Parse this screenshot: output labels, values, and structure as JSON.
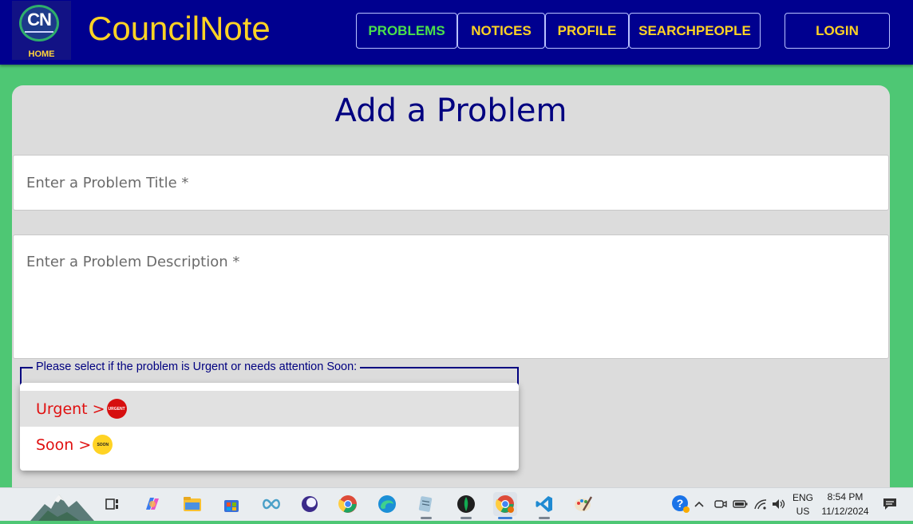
{
  "header": {
    "logo_text": "CN",
    "logo_home": "HOME",
    "brand": "CouncilNote",
    "nav": [
      {
        "label": "PROBLEMS",
        "active": true
      },
      {
        "label": "NOTICES"
      },
      {
        "label": "PROFILE"
      },
      {
        "label": "SEARCHPEOPLE"
      },
      {
        "label": "LOGIN"
      }
    ]
  },
  "form": {
    "title": "Add a Problem",
    "title_placeholder": "Enter a Problem Title *",
    "description_placeholder": "Enter a Problem Description *",
    "priority_legend": "Please select if the problem is Urgent or needs attention Soon:",
    "options": [
      {
        "label": "Urgent >",
        "badge": "URGENT"
      },
      {
        "label": "Soon >",
        "badge": "SOON"
      }
    ]
  },
  "taskbar": {
    "language": "ENG",
    "region": "US",
    "time": "8:54 PM",
    "date": "11/12/2024",
    "apps": [
      "mountain-widget",
      "task-view",
      "copilot",
      "file-explorer",
      "microsoft-store",
      "infinity-app",
      "eclipse-app",
      "chrome",
      "edge",
      "notepad",
      "mongodb-compass",
      "chrome-profile",
      "vscode",
      "paint"
    ]
  },
  "colors": {
    "nav_bg": "#00008f",
    "brand_yellow": "#ffd324",
    "active_green": "#4be04b",
    "page_bg": "#4ec774",
    "card_bg": "#dcdcdc",
    "title_navy": "#000080",
    "option_red": "#e01010"
  }
}
